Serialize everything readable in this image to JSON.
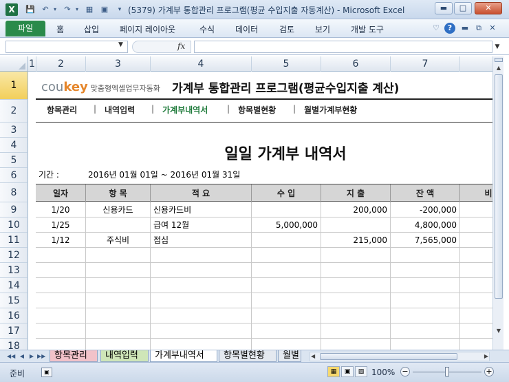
{
  "window": {
    "title": "(5379) 가계부 통합관리 프로그램(평균 수입지출 자동계산)  -  Microsoft Excel",
    "app_icon_letter": "X"
  },
  "ribbon": {
    "file_tab": "파일",
    "tabs": [
      "홈",
      "삽입",
      "페이지 레이아웃",
      "수식",
      "데이터",
      "검토",
      "보기",
      "개발 도구"
    ]
  },
  "formula_bar": {
    "fx": "fx",
    "name_box": "",
    "formula": ""
  },
  "columns": [
    "1",
    "2",
    "3",
    "4",
    "5",
    "6",
    "7"
  ],
  "rows": [
    "1",
    "2",
    "3",
    "4",
    "5",
    "6",
    "8",
    "9",
    "10",
    "11",
    "12",
    "13",
    "14",
    "15",
    "16",
    "17",
    "18"
  ],
  "brand": {
    "cou": "cou",
    "key": "key",
    "tagline": "맞춤형엑셀업무자동화"
  },
  "program_title": "가계부 통합관리 프로그램(평균수입지출 계산)",
  "nav": {
    "items": [
      "항목관리",
      "내역입력",
      "가계부내역서",
      "항목별현황",
      "월별가계부현황"
    ],
    "separator": "|",
    "active_index": 2
  },
  "report": {
    "title": "일일 가계부 내역서",
    "period_label": "기간 :",
    "period_value": "2016년 01월 01일  ~  2016년 01월 31일"
  },
  "table": {
    "headers": [
      "일자",
      "항 목",
      "적 요",
      "수 입",
      "지 출",
      "잔 액",
      "비"
    ],
    "rows": [
      [
        "1/20",
        "신용카드",
        "신용카드비",
        "",
        "200,000",
        "-200,000",
        ""
      ],
      [
        "1/25",
        "",
        "급여 12월",
        "5,000,000",
        "",
        "4,800,000",
        ""
      ],
      [
        "1/12",
        "주식비",
        "점심",
        "",
        "215,000",
        "7,565,000",
        ""
      ]
    ],
    "empty_rows": 7
  },
  "sheets": {
    "tabs": [
      "항목관리",
      "내역입력",
      "가계부내역서",
      "항목별현황",
      "월별"
    ],
    "active_index": 2,
    "colors": [
      "#f2c2c9",
      "#cfe6b8",
      "#ffffff",
      "#e4e9f0",
      "#e4e9f0"
    ]
  },
  "status": {
    "ready": "준비",
    "zoom": "100%",
    "zoom_minus": "−",
    "zoom_plus": "+",
    "zoom_level_percent": 100
  },
  "colors": {
    "accent_green": "#1e7a3a",
    "file_tab": "#2a8a4a",
    "brand_orange": "#e5862b",
    "brand_gray": "#7c8790"
  }
}
